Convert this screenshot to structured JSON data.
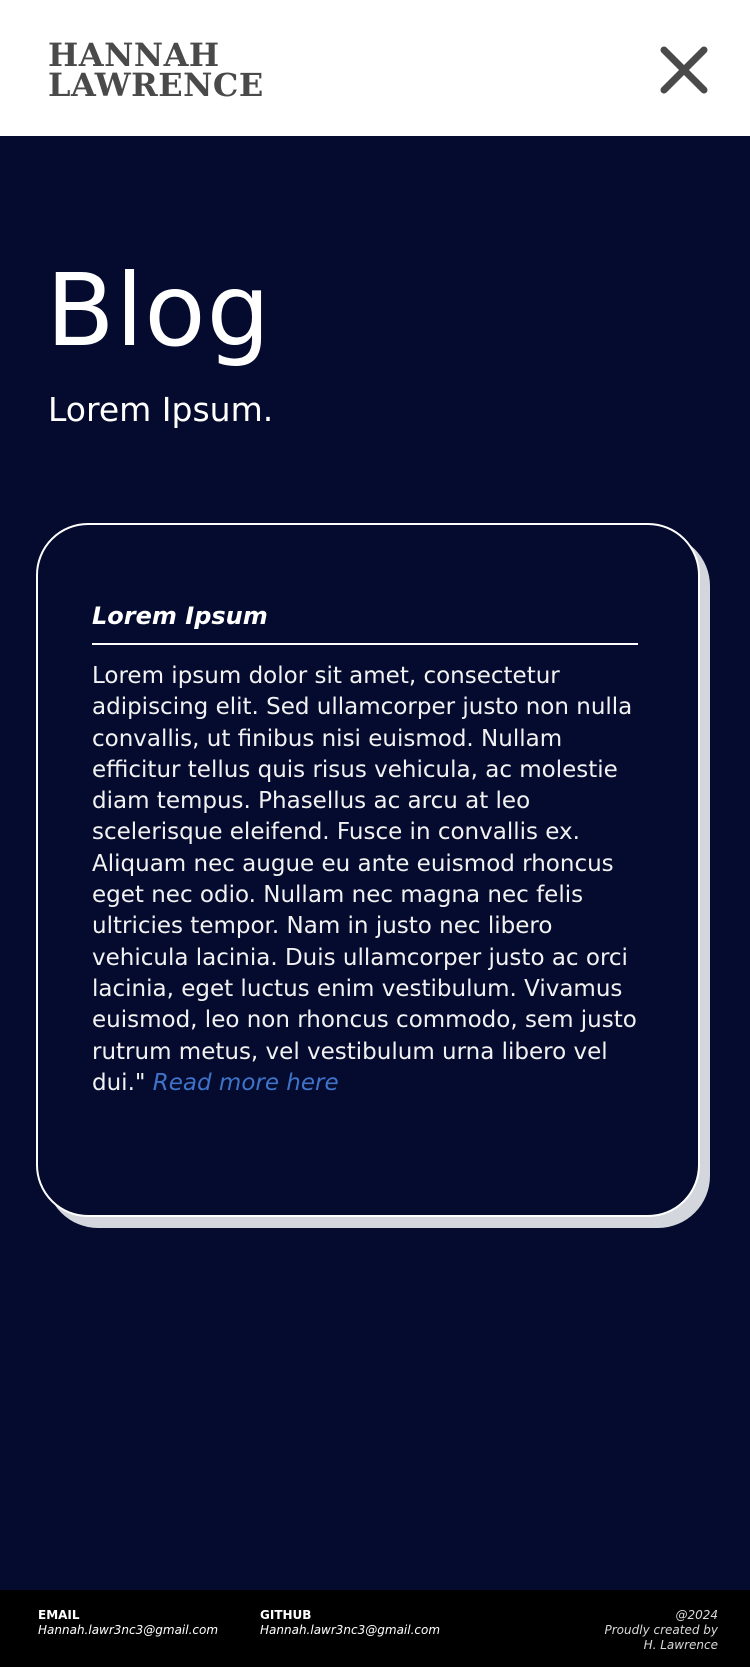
{
  "header": {
    "logo_line1": "HANNAH",
    "logo_line2": "LAWRENCE",
    "close_icon": "close-icon"
  },
  "hero": {
    "title": "Blog",
    "subtitle": "Lorem Ipsum."
  },
  "post": {
    "title": "Lorem Ipsum",
    "body": "Lorem ipsum dolor sit amet, consectetur adipiscing elit. Sed ullamcorper justo non nulla convallis, ut finibus nisi euismod. Nullam efficitur tellus quis risus vehicula, ac molestie diam tempus. Phasellus ac arcu at leo scelerisque eleifend. Fusce in convallis ex. Aliquam nec augue eu ante euismod rhoncus eget nec odio. Nullam nec magna nec felis ultricies tempor. Nam in justo nec libero vehicula lacinia. Duis ullamcorper justo ac orci lacinia, eget luctus enim vestibulum. Vivamus euismod, leo non rhoncus commodo, sem justo rutrum metus, vel vestibulum urna libero vel dui.\"",
    "link_label": "Read more here"
  },
  "footer": {
    "email_label": "EMAIL",
    "email_value": "Hannah.lawr3nc3@gmail.com",
    "github_label": "GITHUB",
    "github_value": "Hannah.lawr3nc3@gmail.com",
    "year": "@2024",
    "credit_line1": "Proudly created by",
    "credit_line2": "H. Lawrence"
  },
  "colors": {
    "background": "#050b2e",
    "header_bg": "#ffffff",
    "logo": "#4a4a4a",
    "link": "#3f73c9",
    "footer_bg": "#000000"
  }
}
